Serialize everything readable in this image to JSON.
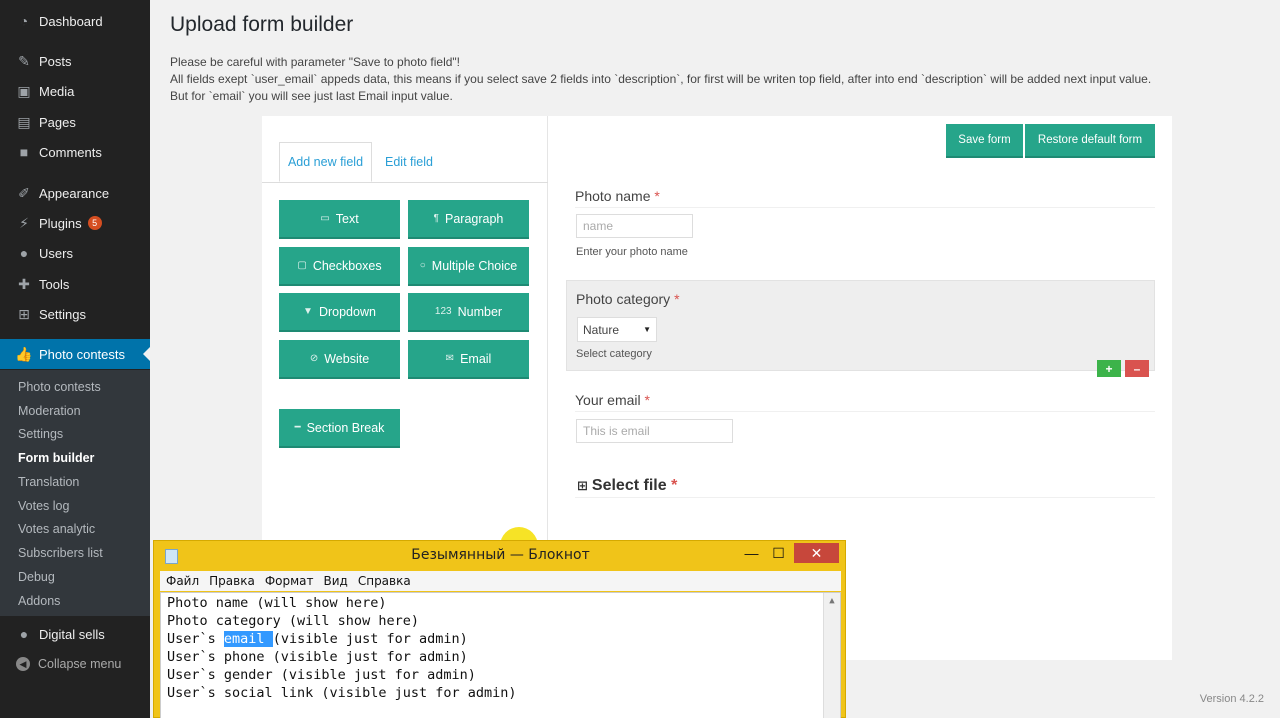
{
  "sidebar": {
    "menu": [
      {
        "label": "Dashboard",
        "icon": "dashboard-icon"
      },
      {
        "label": "Posts",
        "icon": "pin-icon"
      },
      {
        "label": "Media",
        "icon": "media-icon"
      },
      {
        "label": "Pages",
        "icon": "pages-icon"
      },
      {
        "label": "Comments",
        "icon": "comments-icon"
      },
      {
        "label": "Appearance",
        "icon": "brush-icon"
      },
      {
        "label": "Plugins",
        "icon": "plugin-icon",
        "badge": "5"
      },
      {
        "label": "Users",
        "icon": "users-icon"
      },
      {
        "label": "Tools",
        "icon": "wrench-icon"
      },
      {
        "label": "Settings",
        "icon": "settings-icon"
      },
      {
        "label": "Photo contests",
        "icon": "thumbs-up-icon"
      }
    ],
    "submenu": [
      "Photo contests",
      "Moderation",
      "Settings",
      "Form builder",
      "Translation",
      "Votes log",
      "Votes analytic",
      "Subscribers list",
      "Debug",
      "Addons"
    ],
    "digital_sells": "Digital sells",
    "collapse": "Collapse menu"
  },
  "page": {
    "title": "Upload form builder",
    "notice_1": "Please be careful with parameter \"Save to photo field\"!",
    "notice_2": "All fields exept `user_email` appeds data, this means if you select save 2 fields into `description`, for first will be writen top field, after into end `description` will be added next input value.",
    "notice_3": "But for `email` you will see just last Email input value."
  },
  "builder": {
    "tabs": {
      "add": "Add new field",
      "edit": "Edit field"
    },
    "field_buttons": {
      "text": "Text",
      "paragraph": "Paragraph",
      "checkboxes": "Checkboxes",
      "multiple_choice": "Multiple Choice",
      "dropdown": "Dropdown",
      "number": "Number",
      "website": "Website",
      "email": "Email",
      "section_break": "Section Break"
    },
    "save_form": "Save form",
    "restore_default": "Restore default form",
    "required_mark": "*",
    "fields": {
      "photo_name": {
        "label": "Photo name",
        "placeholder": "name",
        "help": "Enter your photo name"
      },
      "photo_category": {
        "label": "Photo category",
        "selected": "Nature",
        "help": "Select category"
      },
      "your_email": {
        "label": "Your email",
        "placeholder": "This is email"
      },
      "select_file": {
        "label": "Select file"
      }
    },
    "add_symbol": "+",
    "remove_symbol": "–"
  },
  "version": "Version 4.2.2",
  "notepad": {
    "title": "Безымянный — Блокнот",
    "menu": [
      "Файл",
      "Правка",
      "Формат",
      "Вид",
      "Справка"
    ],
    "lines": [
      "Photo name (will show here)",
      "Photo category (will show here)",
      "User`s ",
      "User`s phone (visible just for admin)",
      "User`s gender (visible just for admin)",
      "User`s social link (visible just for admin)"
    ],
    "line3_selected": "email ",
    "line3_rest": "(visible just for admin)",
    "close": "✕",
    "maximize": "☐",
    "minimize": "—"
  },
  "colors": {
    "accent": "#26a58a",
    "wp_blue": "#0073aa",
    "sidebar": "#222222",
    "required": "#d9534f",
    "notepad_frame": "#f0c419"
  }
}
